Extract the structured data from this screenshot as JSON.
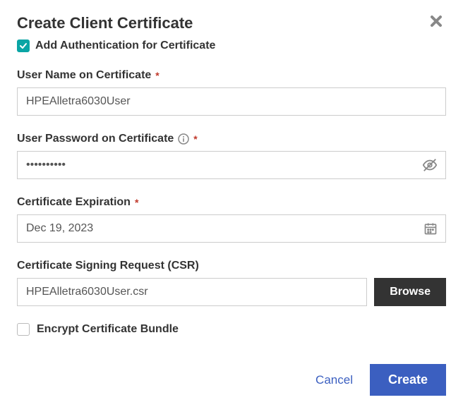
{
  "dialog": {
    "title": "Create Client Certificate",
    "addAuthLabel": "Add Authentication for Certificate",
    "addAuthChecked": true
  },
  "fields": {
    "username": {
      "label": "User Name on Certificate",
      "value": "HPEAlletra6030User"
    },
    "password": {
      "label": "User Password on Certificate",
      "value": "••••••••••"
    },
    "expiration": {
      "label": "Certificate Expiration",
      "value": "Dec 19, 2023"
    },
    "csr": {
      "label": "Certificate Signing Request (CSR)",
      "value": "HPEAlletra6030User.csr",
      "browseLabel": "Browse"
    },
    "encrypt": {
      "label": "Encrypt Certificate Bundle",
      "checked": false
    }
  },
  "footer": {
    "cancel": "Cancel",
    "create": "Create"
  }
}
